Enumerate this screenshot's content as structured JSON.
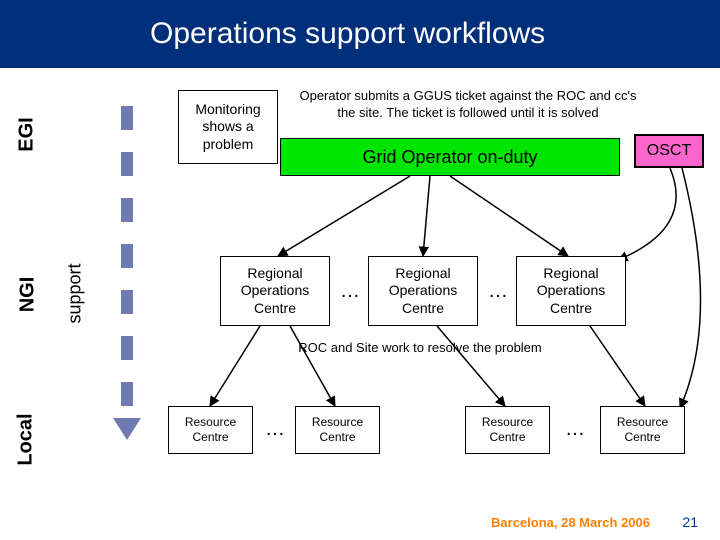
{
  "title": "Operations support workflows",
  "levels": {
    "egi": "EGI",
    "ngi": "NGI",
    "local": "Local",
    "support": "support"
  },
  "monitoring": "Monitoring shows a problem",
  "operator_note": "Operator submits a GGUS ticket against the ROC and cc's the site. The ticket is followed until it is solved",
  "grid_operator": "Grid Operator on-duty",
  "osct": "OSCT",
  "roc": "Regional Operations Centre",
  "resolve_note": "ROC and Site work to resolve  the problem",
  "rc": "Resource Centre",
  "ellipsis": "…",
  "footer": {
    "location": "Barcelona, 28 March 2006",
    "page": "21"
  }
}
